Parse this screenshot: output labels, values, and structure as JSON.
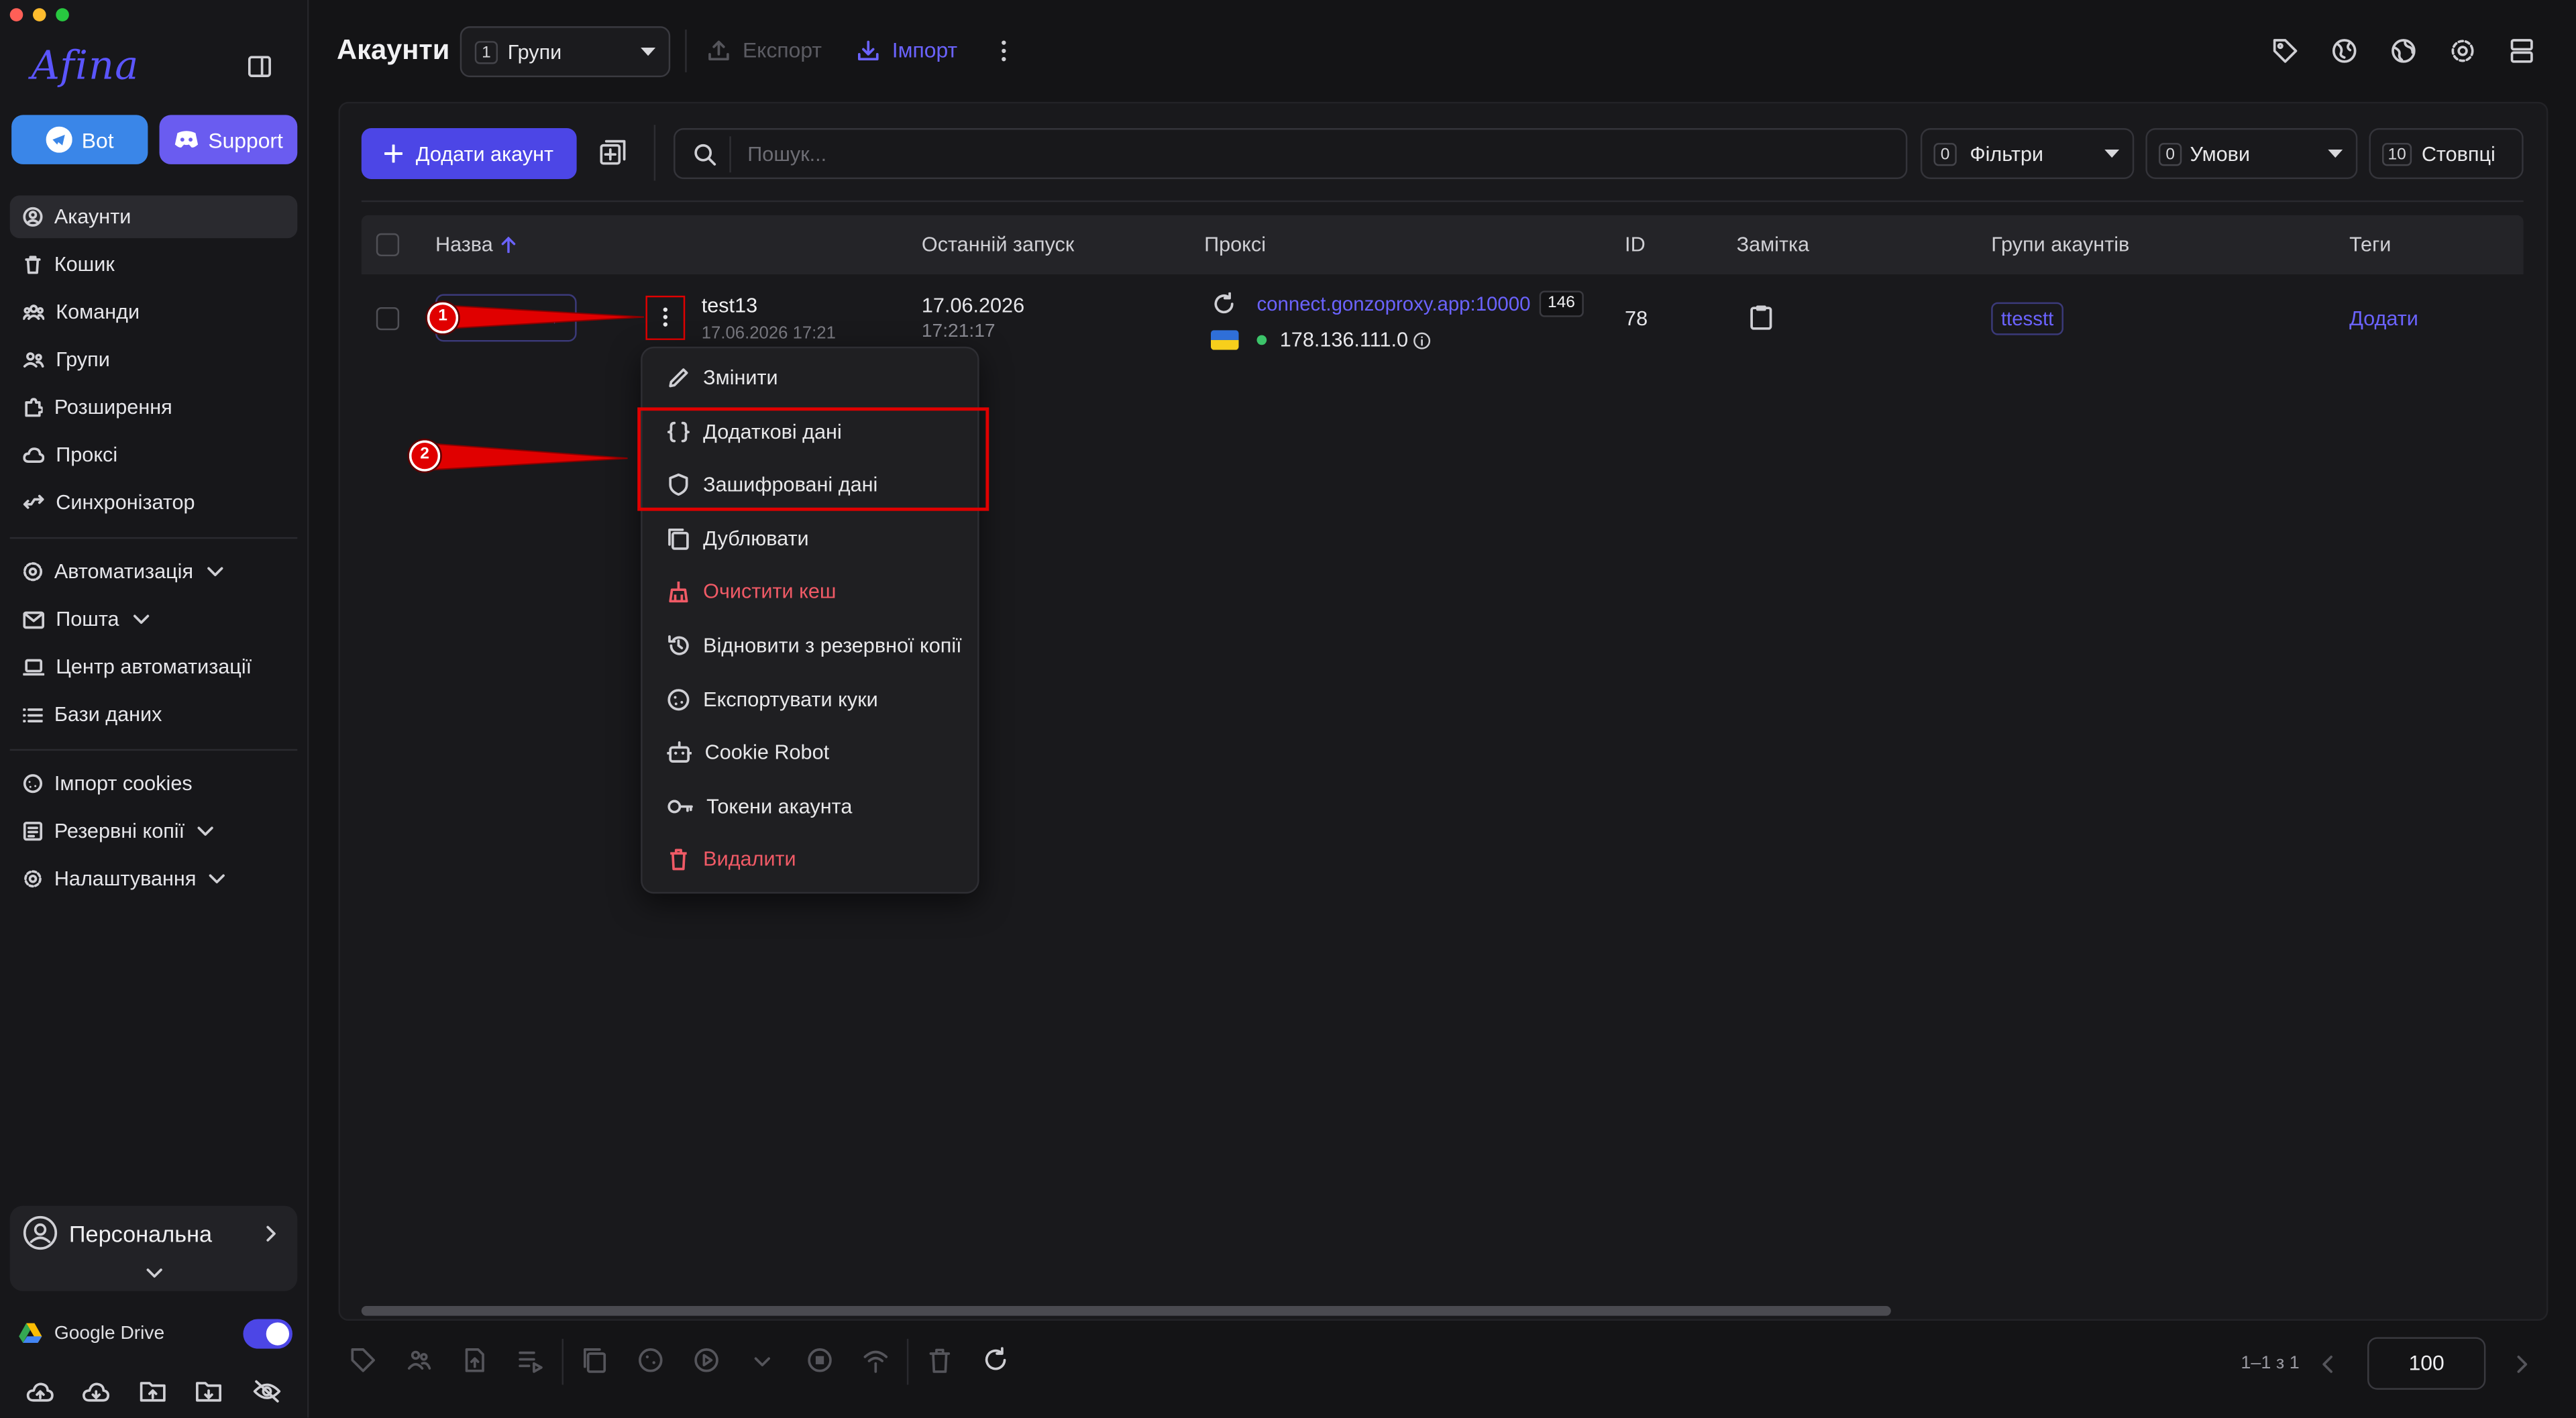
{
  "app": {
    "logo": "Afina"
  },
  "sidebar": {
    "bot_label": "Bot",
    "support_label": "Support",
    "nav": [
      {
        "label": "Акаунти",
        "icon": "user-circle-icon",
        "active": true
      },
      {
        "label": "Кошик",
        "icon": "trash-icon"
      },
      {
        "label": "Команди",
        "icon": "users-icon"
      },
      {
        "label": "Групи",
        "icon": "group-icon"
      },
      {
        "label": "Розширення",
        "icon": "puzzle-icon"
      },
      {
        "label": "Проксі",
        "icon": "cloud-icon"
      },
      {
        "label": "Синхронізатор",
        "icon": "sync-icon"
      },
      {
        "label": "Автоматизація",
        "icon": "automation-icon"
      },
      {
        "label": "Пошта",
        "icon": "mail-icon"
      },
      {
        "label": "Центр автоматизації",
        "icon": "laptop-icon"
      },
      {
        "label": "Бази даних",
        "icon": "list-icon"
      },
      {
        "label": "Імпорт cookies",
        "icon": "cookie-icon"
      },
      {
        "label": "Резервні копії",
        "icon": "backup-icon"
      },
      {
        "label": "Налаштування",
        "icon": "gear-icon"
      }
    ],
    "workspace_label": "Персональна",
    "drive_label": "Google Drive",
    "drive_enabled": true
  },
  "topbar": {
    "title": "Акаунти",
    "groups_count": "1",
    "groups_label": "Групи",
    "export_label": "Експорт",
    "import_label": "Імпорт"
  },
  "toolbar": {
    "add_label": "Додати акаунт",
    "search_placeholder": "Пошук...",
    "filters_count": "0",
    "filters_label": "Фільтри",
    "conditions_count": "0",
    "conditions_label": "Умови",
    "columns_count": "10",
    "columns_label": "Стовпці"
  },
  "table": {
    "headers": [
      "Назва",
      "Останній запуск",
      "Проксі",
      "ID",
      "Замітка",
      "Групи акаунтів",
      "Теги"
    ],
    "rows": [
      {
        "name": "test13",
        "created": "17.06.2026 17:21",
        "last_run_date": "17.06.2026",
        "last_run_time": "17:21:17",
        "proxy_host": "connect.gonzoproxy.app:10000",
        "proxy_badge": "146",
        "proxy_ip": "178.136.111.0",
        "id": "78",
        "group": "ttesstt",
        "tags_action": "Додати"
      }
    ]
  },
  "context_menu": [
    {
      "label": "Змінити",
      "icon": "pencil-icon"
    },
    {
      "label": "Додаткові дані",
      "icon": "braces-icon"
    },
    {
      "label": "Зашифровані дані",
      "icon": "shield-icon"
    },
    {
      "label": "Дублювати",
      "icon": "copy-icon"
    },
    {
      "label": "Очистити кеш",
      "icon": "broom-icon",
      "danger": true
    },
    {
      "label": "Відновити з резервної копії",
      "icon": "history-icon"
    },
    {
      "label": "Експортувати куки",
      "icon": "cookie-icon"
    },
    {
      "label": "Cookie Robot",
      "icon": "robot-icon"
    },
    {
      "label": "Токени акаунта",
      "icon": "key-icon"
    },
    {
      "label": "Видалити",
      "icon": "trash-icon",
      "danger": true
    }
  ],
  "annotations": [
    "1",
    "2"
  ],
  "footer": {
    "range": "1–1 з 1",
    "page_size": "100"
  },
  "colors": {
    "accent": "#4c46e6",
    "link": "#6b63ff",
    "danger": "#f05a66",
    "annotation_red": "#e00000"
  }
}
